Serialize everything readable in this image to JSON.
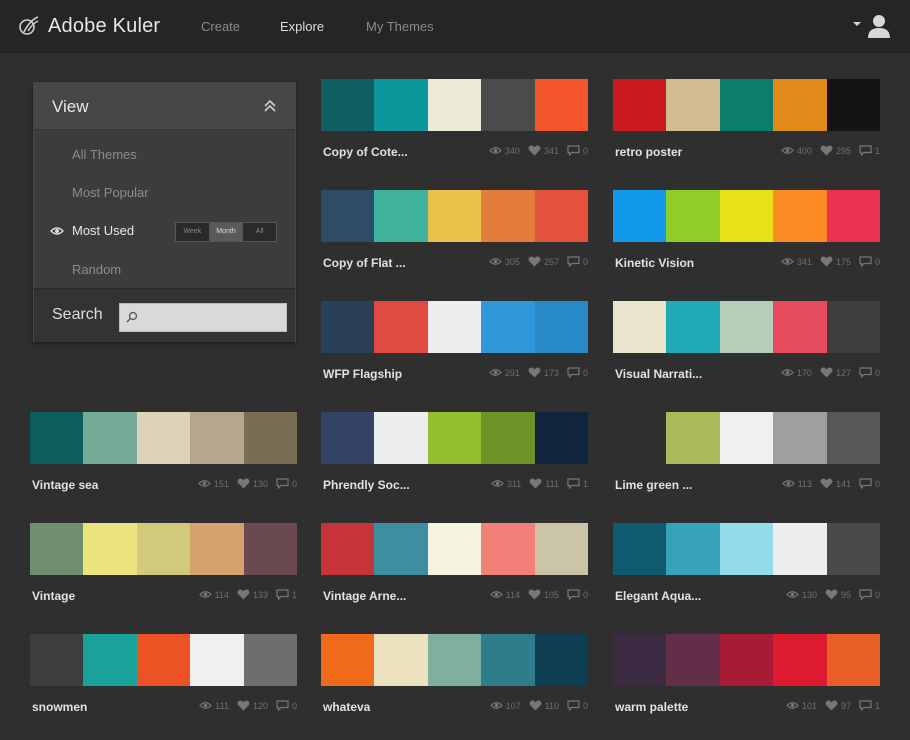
{
  "app": {
    "title": "Adobe Kuler"
  },
  "nav": [
    {
      "label": "Create",
      "active": false
    },
    {
      "label": "Explore",
      "active": true
    },
    {
      "label": "My Themes",
      "active": false
    }
  ],
  "view_panel": {
    "title": "View",
    "items": [
      {
        "label": "All Themes",
        "active": false
      },
      {
        "label": "Most Popular",
        "active": false
      },
      {
        "label": "Most Used",
        "active": true
      },
      {
        "label": "Random",
        "active": false
      }
    ],
    "filters": [
      {
        "label": "Week",
        "active": false
      },
      {
        "label": "Month",
        "active": true
      },
      {
        "label": "All",
        "active": false
      }
    ]
  },
  "search": {
    "label": "Search",
    "placeholder": ""
  },
  "themes": [
    {
      "title": "Copy of Cote...",
      "colors": [
        "#115e63",
        "#0e979a",
        "#ecebd9",
        "#4b4b4b",
        "#f3562b"
      ],
      "views": "340",
      "likes": "341",
      "comments": "0"
    },
    {
      "title": "retro poster",
      "colors": [
        "#c91a1e",
        "#d2bc92",
        "#0c7d6c",
        "#e08a1a",
        "#141414"
      ],
      "views": "400",
      "likes": "295",
      "comments": "1"
    },
    {
      "title": "Copy of Flat ...",
      "colors": [
        "#2d4d66",
        "#3fb39c",
        "#eac24a",
        "#e57d3a",
        "#e5533f"
      ],
      "views": "305",
      "likes": "257",
      "comments": "0"
    },
    {
      "title": "Kinetic Vision",
      "colors": [
        "#1199ea",
        "#90cf2a",
        "#e8df16",
        "#fb8a25",
        "#ea3250"
      ],
      "views": "341",
      "likes": "175",
      "comments": "0"
    },
    {
      "title": "WFP Flagship",
      "colors": [
        "#2a3f58",
        "#e04a40",
        "#ecedee",
        "#2f98da",
        "#2889c9"
      ],
      "views": "291",
      "likes": "173",
      "comments": "0"
    },
    {
      "title": "Visual Narrati...",
      "colors": [
        "#ebe4cc",
        "#21aab7",
        "#b6cdb8",
        "#e54b5c",
        "#3e3e3e"
      ],
      "views": "170",
      "likes": "127",
      "comments": "0"
    },
    {
      "title": "Vintage sea",
      "colors": [
        "#0b5e5b",
        "#74ab98",
        "#dcd3b8",
        "#b5a78c",
        "#7a6d55"
      ],
      "views": "151",
      "likes": "130",
      "comments": "0"
    },
    {
      "title": "Phrendly Soc...",
      "colors": [
        "#334266",
        "#edeef0",
        "#95c02e",
        "#6d9228",
        "#10243b"
      ],
      "views": "311",
      "likes": "111",
      "comments": "1"
    },
    {
      "title": "Lime green ...",
      "colors": [
        "#2f2f2f",
        "#a9ba59",
        "#eef0ef",
        "#9e9e9e",
        "#585858"
      ],
      "views": "113",
      "likes": "141",
      "comments": "0"
    },
    {
      "title": "Vintage",
      "colors": [
        "#6f8e72",
        "#ece47e",
        "#d2c97b",
        "#d7a16f",
        "#6b4a4f"
      ],
      "views": "114",
      "likes": "133",
      "comments": "1"
    },
    {
      "title": "Vintage Arne...",
      "colors": [
        "#c7343a",
        "#3d8ea0",
        "#f5f3e2",
        "#f08078",
        "#cbc3a6"
      ],
      "views": "114",
      "likes": "105",
      "comments": "0"
    },
    {
      "title": "Elegant Aqua...",
      "colors": [
        "#0f5a6c",
        "#36a2bc",
        "#92dde9",
        "#ecedee",
        "#4a4a4a"
      ],
      "views": "130",
      "likes": "95",
      "comments": "0"
    },
    {
      "title": "snowmen",
      "colors": [
        "#3d3d3d",
        "#18a299",
        "#ec5426",
        "#efeff0",
        "#6e6e6e"
      ],
      "views": "111",
      "likes": "120",
      "comments": "0"
    },
    {
      "title": "whateva",
      "colors": [
        "#f06a1c",
        "#ede2c0",
        "#7fad9f",
        "#2d7d8c",
        "#0f3e52"
      ],
      "views": "107",
      "likes": "110",
      "comments": "0"
    },
    {
      "title": "warm palette",
      "colors": [
        "#3c2a42",
        "#622e48",
        "#a81b36",
        "#dd1a30",
        "#e96127"
      ],
      "views": "101",
      "likes": "97",
      "comments": "1"
    }
  ]
}
